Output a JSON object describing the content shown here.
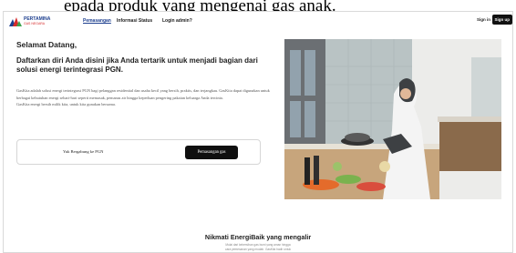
{
  "top_caption": "epada produk yang mengenai gas anak.",
  "nav": {
    "logo_name": "PERTAMINA",
    "logo_sub": "GAS NEGARA",
    "links": [
      "Pemasangan",
      "Informasi Status",
      "Login admin?"
    ],
    "signin": "Sign in",
    "signup": "Sign up"
  },
  "hero": {
    "welcome": "Selamat Datang,",
    "headline": "Daftarkan diri Anda disini jika Anda tertarik untuk menjadi bagian dari solusi energi terintegrasi PGN.",
    "paragraph": "GasKita adalah solusi energi terintegrasi PGN bagi pelanggan residential dan usaha kecil yang bersih, praktis, dan terjangkau. GasKita dapat digunakan untuk berbagai kebutuhan energi sehari-hari seperti memasak, pemanas air hingga keperluan pengering pakaian keluarga Anda tercinta.",
    "paragraph2": "GasKita energi bersih milik kita, untuk kita gunakan bersama.",
    "cta_text": "Yuk Bergabung ke PGN",
    "cta_button": "Pemasangan gas"
  },
  "section": {
    "title": "Nikmati EnergiBaik yang mengalir",
    "subtitle_1": "Mulai dari kebersihan gas bumi yang aman hingga",
    "subtitle_2": "cara pemesanan yang mudah. GasKita hadir untuk"
  },
  "colors": {
    "brand_blue": "#1d3f8f",
    "brand_red": "#d62b2b",
    "button_dark": "#0f0f0f"
  }
}
